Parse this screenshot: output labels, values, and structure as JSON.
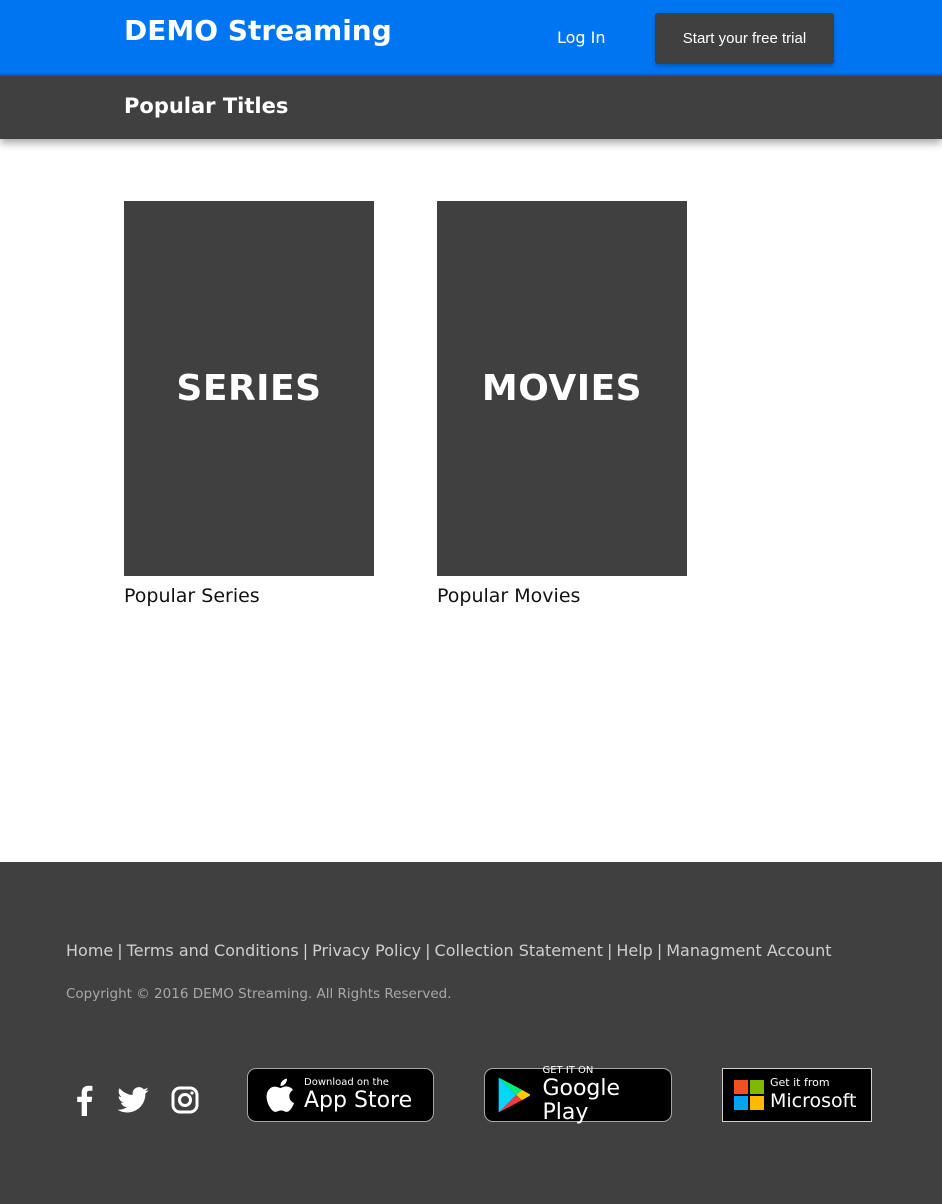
{
  "header": {
    "brand": "DEMO Streaming",
    "login_label": "Log In",
    "trial_label": "Start your free trial"
  },
  "subheader": {
    "title": "Popular Titles"
  },
  "tiles": [
    {
      "tile_text": "SERIES",
      "caption": "Popular Series"
    },
    {
      "tile_text": "MOVIES",
      "caption": "Popular Movies"
    }
  ],
  "footer": {
    "links": [
      "Home",
      "Terms and Conditions",
      "Privacy Policy",
      "Collection Statement",
      "Help",
      "Managment Account"
    ],
    "separator": "|",
    "copyright": "Copyright © 2016 DEMO Streaming. All Rights Reserved.",
    "social_icons": [
      "facebook-icon",
      "twitter-icon",
      "instagram-icon"
    ],
    "badges": {
      "app_store": {
        "line1": "Download on the",
        "line2": "App Store"
      },
      "google_play": {
        "line1": "GET IT ON",
        "line2": "Google Play"
      },
      "microsoft": {
        "line1": "Get it from",
        "line2": "Microsoft"
      }
    }
  },
  "colors": {
    "primary": "#0075f2",
    "dark": "#404040",
    "white": "#ffffff"
  }
}
